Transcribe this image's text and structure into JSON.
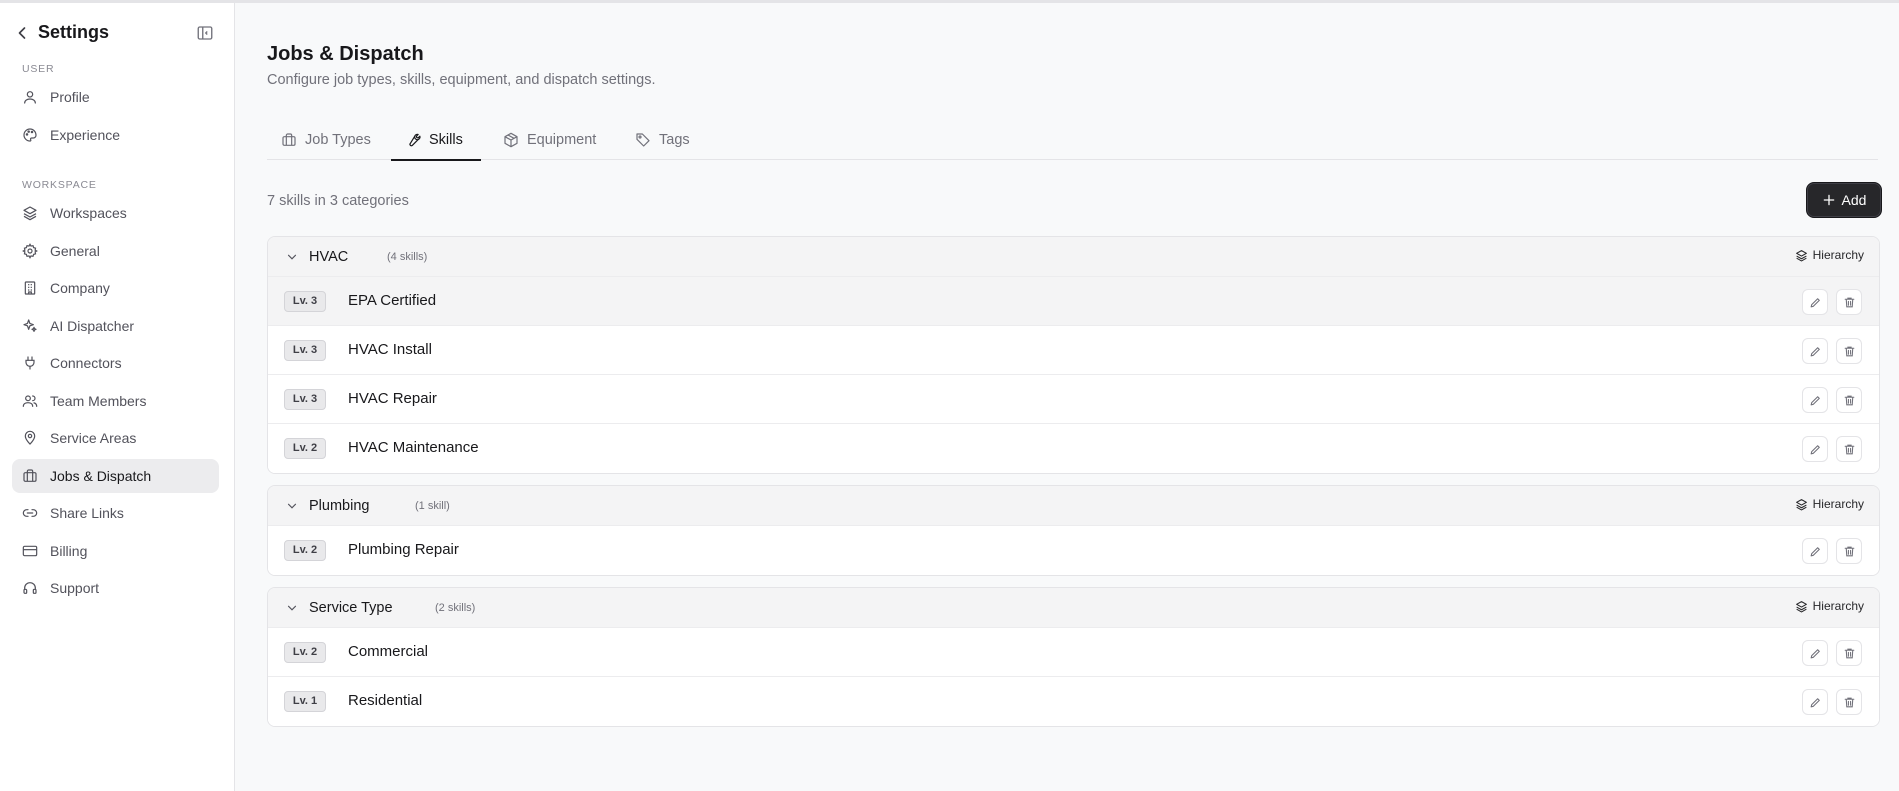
{
  "sidebar": {
    "title": "Settings",
    "sections": [
      {
        "label": "USER"
      },
      {
        "label": "WORKSPACE"
      }
    ],
    "items": [
      {
        "label": "Profile",
        "icon": "user-icon"
      },
      {
        "label": "Experience",
        "icon": "palette-icon"
      },
      {
        "label": "Workspaces",
        "icon": "layers-icon"
      },
      {
        "label": "General",
        "icon": "gear-icon"
      },
      {
        "label": "Company",
        "icon": "building-icon"
      },
      {
        "label": "AI Dispatcher",
        "icon": "sparkles-icon"
      },
      {
        "label": "Connectors",
        "icon": "plug-icon"
      },
      {
        "label": "Team Members",
        "icon": "users-icon"
      },
      {
        "label": "Service Areas",
        "icon": "map-pin-icon"
      },
      {
        "label": "Jobs & Dispatch",
        "icon": "briefcase-icon",
        "active": true
      },
      {
        "label": "Share Links",
        "icon": "link-icon"
      },
      {
        "label": "Billing",
        "icon": "credit-card-icon"
      },
      {
        "label": "Support",
        "icon": "headset-icon"
      }
    ]
  },
  "page": {
    "title": "Jobs & Dispatch",
    "subtitle": "Configure job types, skills, equipment, and dispatch settings."
  },
  "tabs": [
    {
      "label": "Job Types",
      "icon": "briefcase-icon"
    },
    {
      "label": "Skills",
      "icon": "wrench-icon",
      "active": true
    },
    {
      "label": "Equipment",
      "icon": "box-icon"
    },
    {
      "label": "Tags",
      "icon": "tag-icon"
    }
  ],
  "skills": {
    "summary": "7 skills in 3 categories",
    "add_label": "Add",
    "hierarchy_label": "Hierarchy",
    "groups": [
      {
        "name": "HVAC",
        "count": "(4 skills)",
        "items": [
          {
            "level": "Lv. 3",
            "name": "EPA Certified"
          },
          {
            "level": "Lv. 3",
            "name": "HVAC Install"
          },
          {
            "level": "Lv. 3",
            "name": "HVAC Repair"
          },
          {
            "level": "Lv. 2",
            "name": "HVAC Maintenance"
          }
        ]
      },
      {
        "name": "Plumbing",
        "count": "(1 skill)",
        "items": [
          {
            "level": "Lv. 2",
            "name": "Plumbing Repair"
          }
        ]
      },
      {
        "name": "Service Type",
        "count": "(2 skills)",
        "items": [
          {
            "level": "Lv. 2",
            "name": "Commercial"
          },
          {
            "level": "Lv. 1",
            "name": "Residential"
          }
        ]
      }
    ]
  },
  "colors": {
    "accent": "#27272a",
    "active_nav_bg": "#ececee",
    "background": "#f8f9fa"
  }
}
